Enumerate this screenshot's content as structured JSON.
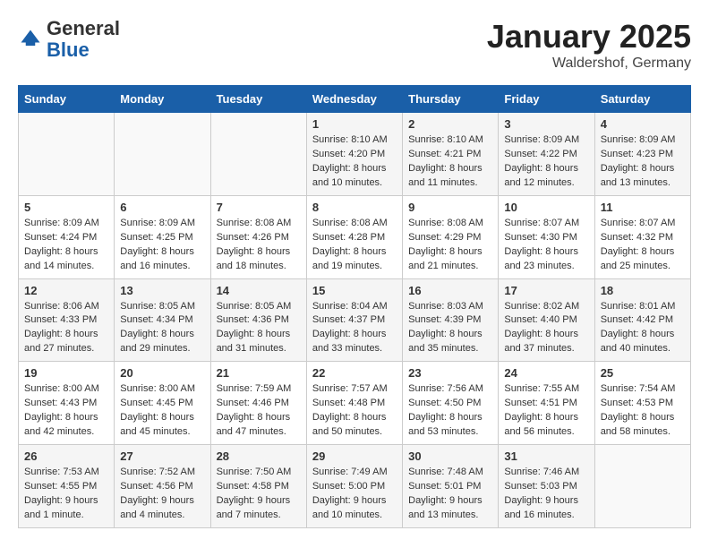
{
  "header": {
    "logo_general": "General",
    "logo_blue": "Blue",
    "title": "January 2025",
    "subtitle": "Waldershof, Germany"
  },
  "weekdays": [
    "Sunday",
    "Monday",
    "Tuesday",
    "Wednesday",
    "Thursday",
    "Friday",
    "Saturday"
  ],
  "weeks": [
    [
      {
        "day": "",
        "info": ""
      },
      {
        "day": "",
        "info": ""
      },
      {
        "day": "",
        "info": ""
      },
      {
        "day": "1",
        "info": "Sunrise: 8:10 AM\nSunset: 4:20 PM\nDaylight: 8 hours\nand 10 minutes."
      },
      {
        "day": "2",
        "info": "Sunrise: 8:10 AM\nSunset: 4:21 PM\nDaylight: 8 hours\nand 11 minutes."
      },
      {
        "day": "3",
        "info": "Sunrise: 8:09 AM\nSunset: 4:22 PM\nDaylight: 8 hours\nand 12 minutes."
      },
      {
        "day": "4",
        "info": "Sunrise: 8:09 AM\nSunset: 4:23 PM\nDaylight: 8 hours\nand 13 minutes."
      }
    ],
    [
      {
        "day": "5",
        "info": "Sunrise: 8:09 AM\nSunset: 4:24 PM\nDaylight: 8 hours\nand 14 minutes."
      },
      {
        "day": "6",
        "info": "Sunrise: 8:09 AM\nSunset: 4:25 PM\nDaylight: 8 hours\nand 16 minutes."
      },
      {
        "day": "7",
        "info": "Sunrise: 8:08 AM\nSunset: 4:26 PM\nDaylight: 8 hours\nand 18 minutes."
      },
      {
        "day": "8",
        "info": "Sunrise: 8:08 AM\nSunset: 4:28 PM\nDaylight: 8 hours\nand 19 minutes."
      },
      {
        "day": "9",
        "info": "Sunrise: 8:08 AM\nSunset: 4:29 PM\nDaylight: 8 hours\nand 21 minutes."
      },
      {
        "day": "10",
        "info": "Sunrise: 8:07 AM\nSunset: 4:30 PM\nDaylight: 8 hours\nand 23 minutes."
      },
      {
        "day": "11",
        "info": "Sunrise: 8:07 AM\nSunset: 4:32 PM\nDaylight: 8 hours\nand 25 minutes."
      }
    ],
    [
      {
        "day": "12",
        "info": "Sunrise: 8:06 AM\nSunset: 4:33 PM\nDaylight: 8 hours\nand 27 minutes."
      },
      {
        "day": "13",
        "info": "Sunrise: 8:05 AM\nSunset: 4:34 PM\nDaylight: 8 hours\nand 29 minutes."
      },
      {
        "day": "14",
        "info": "Sunrise: 8:05 AM\nSunset: 4:36 PM\nDaylight: 8 hours\nand 31 minutes."
      },
      {
        "day": "15",
        "info": "Sunrise: 8:04 AM\nSunset: 4:37 PM\nDaylight: 8 hours\nand 33 minutes."
      },
      {
        "day": "16",
        "info": "Sunrise: 8:03 AM\nSunset: 4:39 PM\nDaylight: 8 hours\nand 35 minutes."
      },
      {
        "day": "17",
        "info": "Sunrise: 8:02 AM\nSunset: 4:40 PM\nDaylight: 8 hours\nand 37 minutes."
      },
      {
        "day": "18",
        "info": "Sunrise: 8:01 AM\nSunset: 4:42 PM\nDaylight: 8 hours\nand 40 minutes."
      }
    ],
    [
      {
        "day": "19",
        "info": "Sunrise: 8:00 AM\nSunset: 4:43 PM\nDaylight: 8 hours\nand 42 minutes."
      },
      {
        "day": "20",
        "info": "Sunrise: 8:00 AM\nSunset: 4:45 PM\nDaylight: 8 hours\nand 45 minutes."
      },
      {
        "day": "21",
        "info": "Sunrise: 7:59 AM\nSunset: 4:46 PM\nDaylight: 8 hours\nand 47 minutes."
      },
      {
        "day": "22",
        "info": "Sunrise: 7:57 AM\nSunset: 4:48 PM\nDaylight: 8 hours\nand 50 minutes."
      },
      {
        "day": "23",
        "info": "Sunrise: 7:56 AM\nSunset: 4:50 PM\nDaylight: 8 hours\nand 53 minutes."
      },
      {
        "day": "24",
        "info": "Sunrise: 7:55 AM\nSunset: 4:51 PM\nDaylight: 8 hours\nand 56 minutes."
      },
      {
        "day": "25",
        "info": "Sunrise: 7:54 AM\nSunset: 4:53 PM\nDaylight: 8 hours\nand 58 minutes."
      }
    ],
    [
      {
        "day": "26",
        "info": "Sunrise: 7:53 AM\nSunset: 4:55 PM\nDaylight: 9 hours\nand 1 minute."
      },
      {
        "day": "27",
        "info": "Sunrise: 7:52 AM\nSunset: 4:56 PM\nDaylight: 9 hours\nand 4 minutes."
      },
      {
        "day": "28",
        "info": "Sunrise: 7:50 AM\nSunset: 4:58 PM\nDaylight: 9 hours\nand 7 minutes."
      },
      {
        "day": "29",
        "info": "Sunrise: 7:49 AM\nSunset: 5:00 PM\nDaylight: 9 hours\nand 10 minutes."
      },
      {
        "day": "30",
        "info": "Sunrise: 7:48 AM\nSunset: 5:01 PM\nDaylight: 9 hours\nand 13 minutes."
      },
      {
        "day": "31",
        "info": "Sunrise: 7:46 AM\nSunset: 5:03 PM\nDaylight: 9 hours\nand 16 minutes."
      },
      {
        "day": "",
        "info": ""
      }
    ]
  ]
}
